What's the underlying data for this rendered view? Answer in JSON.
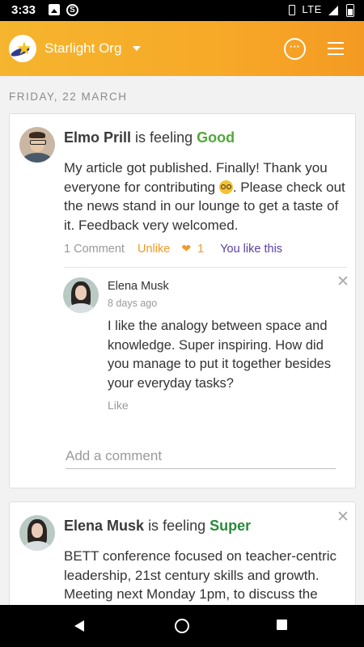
{
  "status_bar": {
    "time": "3:33",
    "network": "LTE"
  },
  "app_bar": {
    "org_name": "Starlight Org",
    "more_icon": "more-circle-icon",
    "menu_icon": "hamburger-menu-icon"
  },
  "feed": {
    "date_header": "FRIDAY, 22 MARCH",
    "posts": [
      {
        "author": "Elmo Prill",
        "feeling_prefix": "is feeling",
        "feeling": "Good",
        "body_before_emoji": "My article got published. Finally! Thank you everyone for contributing ",
        "body_after_emoji": ". Please check out the news stand in our lounge to get a taste of it. Feedback very welcomed.",
        "comments_label": "1  Comment",
        "unlike_label": "Unlike",
        "like_count": "1",
        "you_like_label": "You like this",
        "comment": {
          "author": "Elena Musk",
          "time": "8 days ago",
          "body": "I like the analogy between space and knowledge. Super inspiring. How did you manage to put it together besides your everyday tasks?",
          "like_label": "Like"
        },
        "add_comment_placeholder": "Add a comment"
      },
      {
        "author": "Elena Musk",
        "feeling_prefix": "is feeling",
        "feeling": "Super",
        "body": "BETT conference focused on teacher-centric leadership, 21st century skills and growth. Meeting next Monday 1pm, to discuss the main takeaways and next steps for our team."
      }
    ]
  },
  "colors": {
    "accent": "#f7a928",
    "good": "#52a83a",
    "super": "#2a8a3a",
    "like": "#f39a26",
    "you_like": "#5b3fa3"
  }
}
